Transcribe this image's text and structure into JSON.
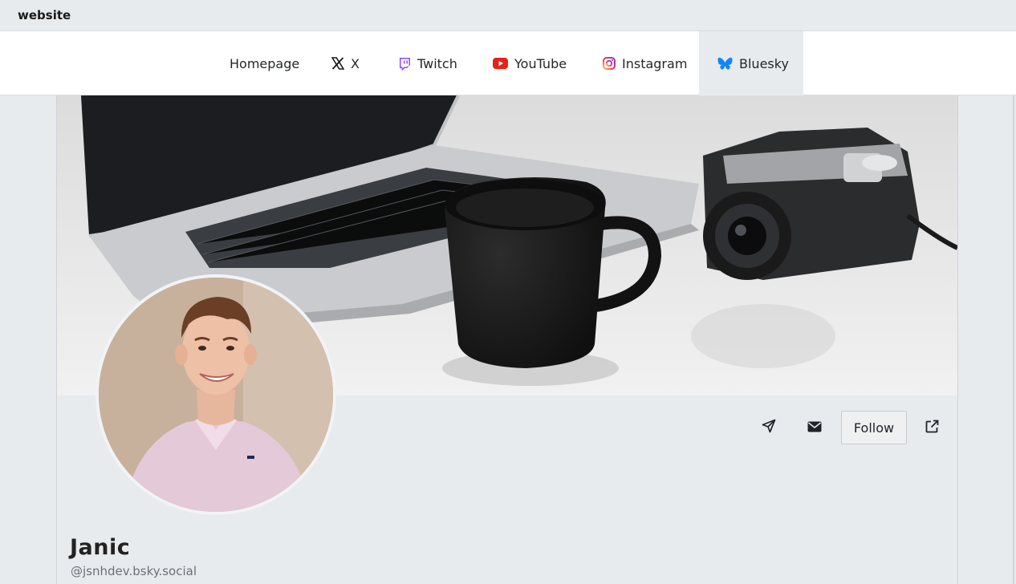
{
  "browser": {
    "title": "website"
  },
  "nav": {
    "items": [
      {
        "label": "Homepage",
        "icon": ""
      },
      {
        "label": "X",
        "icon": "x-logo-icon"
      },
      {
        "label": "Twitch",
        "icon": "twitch-icon",
        "color": "#9146ff"
      },
      {
        "label": "YouTube",
        "icon": "youtube-icon",
        "color": "#e62117"
      },
      {
        "label": "Instagram",
        "icon": "instagram-icon",
        "color": "#d6249f"
      },
      {
        "label": "Bluesky",
        "icon": "bluesky-butterfly-icon",
        "color": "#1185fe",
        "active": true
      }
    ]
  },
  "profile": {
    "display_name": "Janic",
    "handle": "@jsnhdev.bsky.social",
    "actions": {
      "follow_label": "Follow"
    }
  }
}
